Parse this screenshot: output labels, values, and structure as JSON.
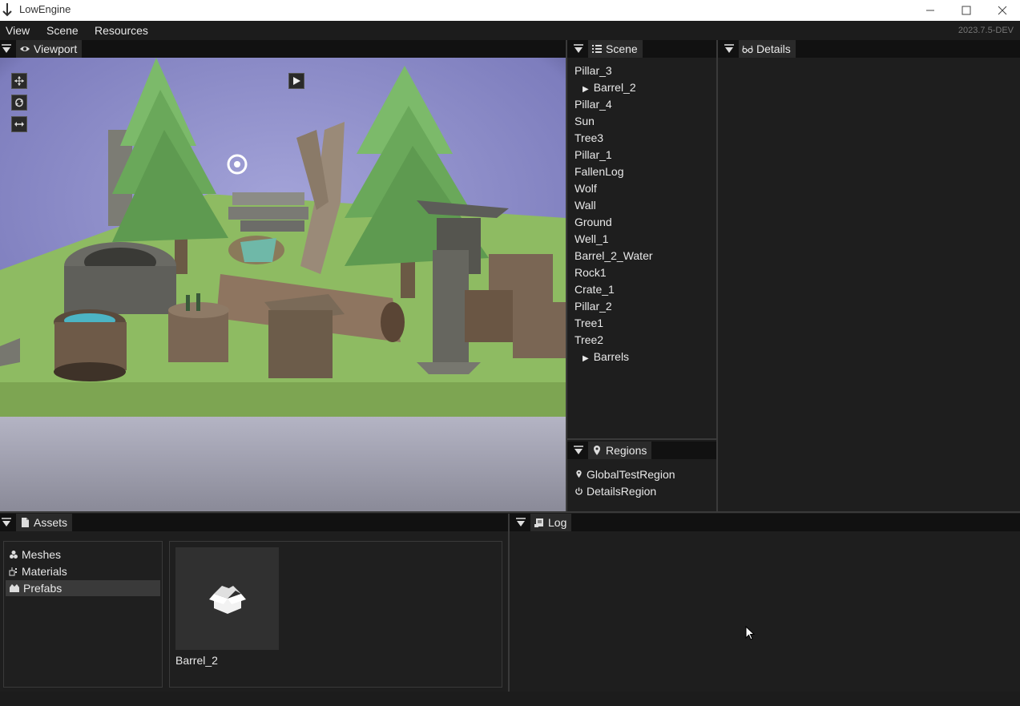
{
  "window": {
    "title": "LowEngine",
    "version": "2023.7.5-DEV",
    "icons": {
      "app": "down-arrow-icon",
      "minimize": "minimize-icon",
      "maximize": "maximize-icon",
      "close": "close-icon"
    }
  },
  "menu": {
    "items": [
      "View",
      "Scene",
      "Resources"
    ]
  },
  "viewport": {
    "tab_label": "Viewport",
    "tab_icon": "eye-icon",
    "tools": [
      "move-tool-icon",
      "rotate-tool-icon",
      "scale-tool-icon"
    ],
    "play_icon": "play-icon",
    "gizmo_icon": "sun-gear-icon"
  },
  "scene": {
    "tab_label": "Scene",
    "tab_icon": "list-icon",
    "items": [
      {
        "label": "Pillar_3",
        "expandable": false
      },
      {
        "label": "Barrel_2",
        "expandable": true
      },
      {
        "label": "Pillar_4",
        "expandable": false
      },
      {
        "label": "Sun",
        "expandable": false
      },
      {
        "label": "Tree3",
        "expandable": false
      },
      {
        "label": "Pillar_1",
        "expandable": false
      },
      {
        "label": "FallenLog",
        "expandable": false
      },
      {
        "label": "Wolf",
        "expandable": false
      },
      {
        "label": "Wall",
        "expandable": false
      },
      {
        "label": "Ground",
        "expandable": false
      },
      {
        "label": "Well_1",
        "expandable": false
      },
      {
        "label": "Barrel_2_Water",
        "expandable": false
      },
      {
        "label": "Rock1",
        "expandable": false
      },
      {
        "label": "Crate_1",
        "expandable": false
      },
      {
        "label": "Pillar_2",
        "expandable": false
      },
      {
        "label": "Tree1",
        "expandable": false
      },
      {
        "label": "Tree2",
        "expandable": false
      },
      {
        "label": "Barrels",
        "expandable": true
      }
    ]
  },
  "details": {
    "tab_label": "Details",
    "tab_icon": "glasses-icon"
  },
  "regions": {
    "tab_label": "Regions",
    "tab_icon": "map-pin-icon",
    "items": [
      {
        "label": "GlobalTestRegion",
        "icon": "map-pin-icon"
      },
      {
        "label": "DetailsRegion",
        "icon": "power-icon"
      }
    ]
  },
  "assets": {
    "tab_label": "Assets",
    "tab_icon": "file-icon",
    "folders": [
      {
        "label": "Meshes",
        "icon": "shapes-icon",
        "selected": false
      },
      {
        "label": "Materials",
        "icon": "paint-icon",
        "selected": false
      },
      {
        "label": "Prefabs",
        "icon": "boxes-icon",
        "selected": true
      }
    ],
    "files": [
      {
        "label": "Barrel_2",
        "icon": "open-box-icon"
      }
    ]
  },
  "log": {
    "tab_label": "Log",
    "tab_icon": "scroll-icon"
  },
  "colors": {
    "background": "#1c1c1c",
    "panel": "#1e1e1e",
    "header": "#111111",
    "tab": "#2a2a2a",
    "sky": "#8c8cc8",
    "grass": "#8cb464"
  }
}
